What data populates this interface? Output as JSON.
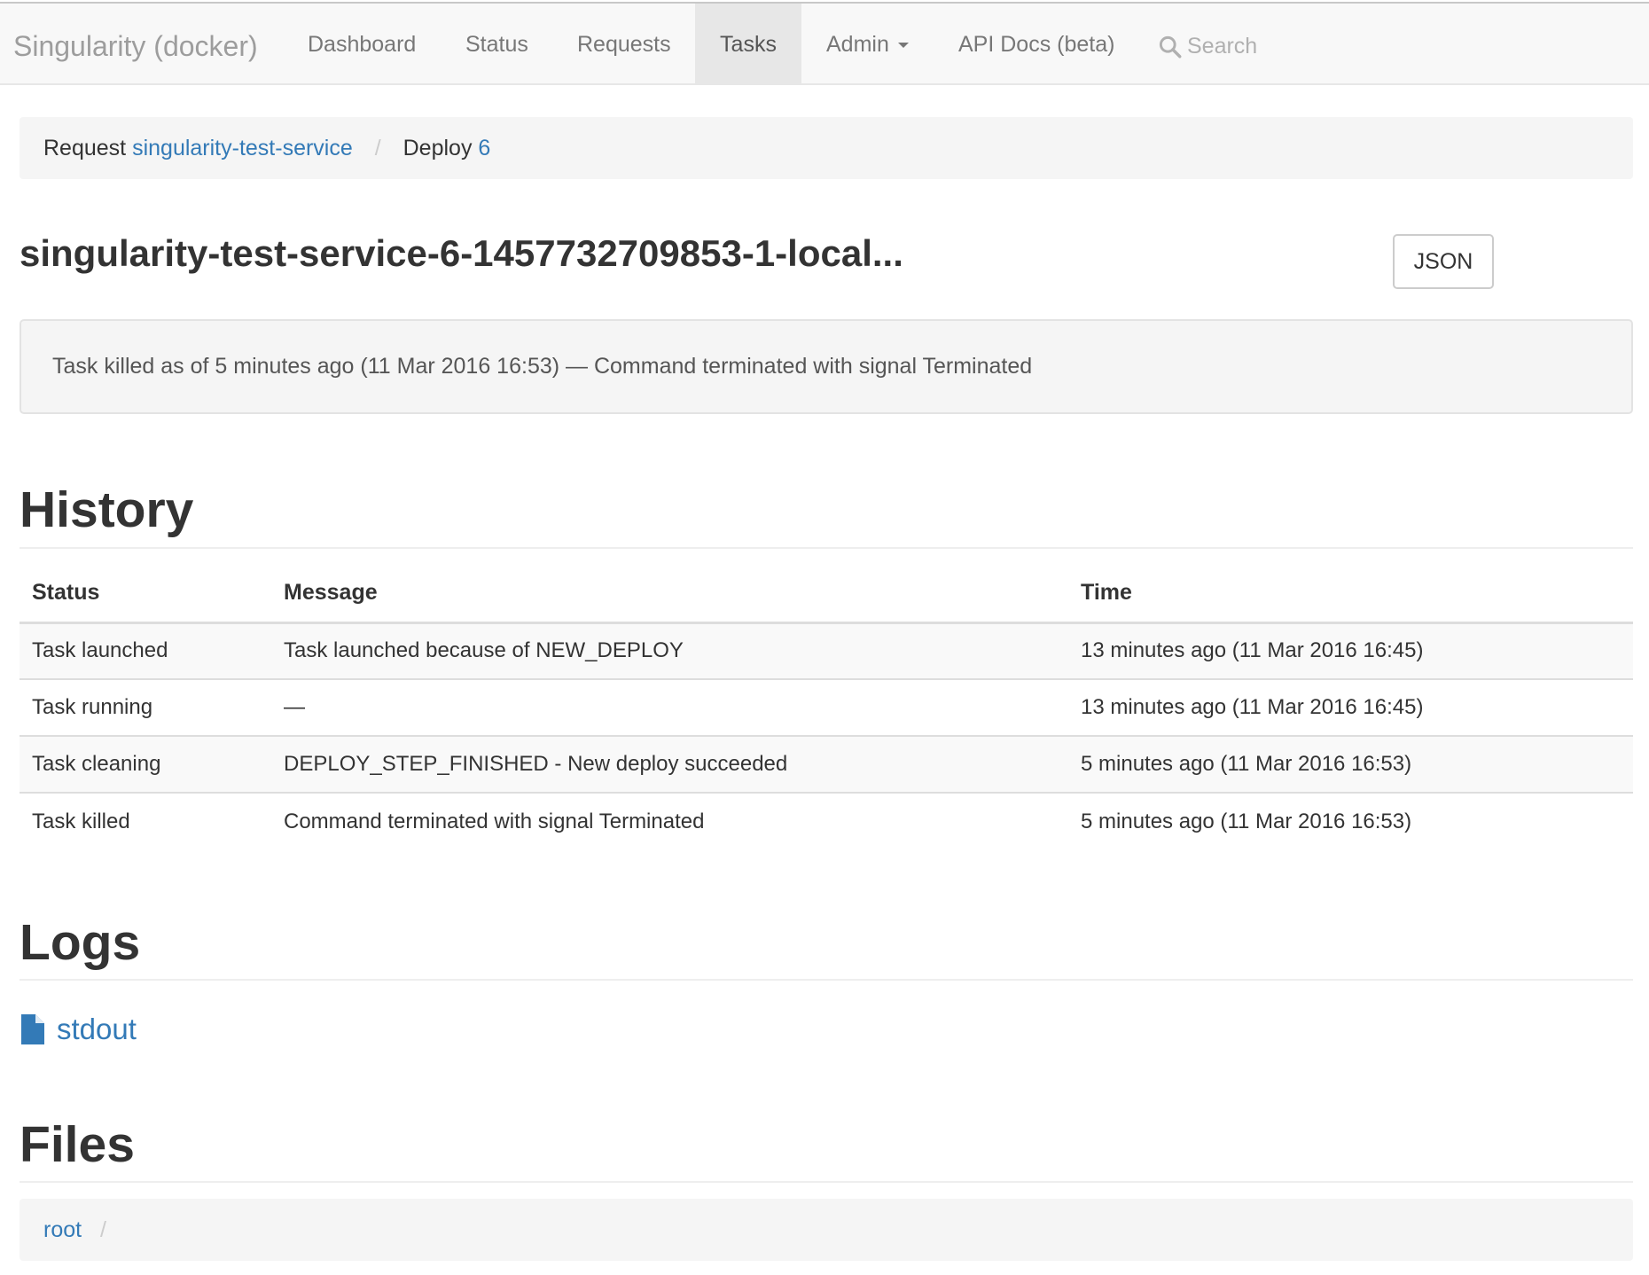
{
  "navbar": {
    "brand": "Singularity (docker)",
    "items": [
      {
        "label": "Dashboard"
      },
      {
        "label": "Status"
      },
      {
        "label": "Requests"
      },
      {
        "label": "Tasks",
        "active": true
      },
      {
        "label": "Admin"
      },
      {
        "label": "API Docs (beta)"
      }
    ],
    "search_label": "Search",
    "icons": {
      "search": "search-icon",
      "admin_dropdown": "caret-down-icon"
    }
  },
  "breadcrumb": {
    "request_prefix": "Request",
    "request_id": "singularity-test-service",
    "separator": "/",
    "deploy_prefix": "Deploy",
    "deploy_id": "6"
  },
  "task": {
    "title": "singularity-test-service-6-1457732709853-1-local...",
    "json_button": "JSON",
    "status_message": "Task killed as of 5 minutes ago (11 Mar 2016 16:53) — Command terminated with signal Terminated"
  },
  "history": {
    "heading": "History",
    "columns": [
      "Status",
      "Message",
      "Time"
    ],
    "rows": [
      {
        "status": "Task launched",
        "message": "Task launched because of NEW_DEPLOY",
        "time": "13 minutes ago (11 Mar 2016 16:45)"
      },
      {
        "status": "Task running",
        "message": "—",
        "time": "13 minutes ago (11 Mar 2016 16:45)"
      },
      {
        "status": "Task cleaning",
        "message": "DEPLOY_STEP_FINISHED - New deploy succeeded",
        "time": "5 minutes ago (11 Mar 2016 16:53)"
      },
      {
        "status": "Task killed",
        "message": "Command terminated with signal Terminated",
        "time": "5 minutes ago (11 Mar 2016 16:53)"
      }
    ]
  },
  "logs": {
    "heading": "Logs",
    "items": [
      {
        "label": "stdout",
        "icon": "file-icon"
      }
    ]
  },
  "files": {
    "heading": "Files",
    "root_label": "root",
    "separator": "/"
  },
  "colors": {
    "link": "#337ab7",
    "navbar_bg": "#f8f8f8",
    "active_tab_bg": "#e7e7e7",
    "well_bg": "#f5f5f5"
  }
}
